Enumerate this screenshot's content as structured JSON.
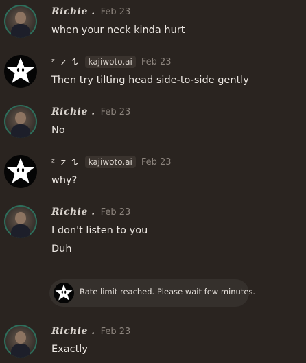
{
  "messages": [
    {
      "sender": "Richie .",
      "date": "Feb 23",
      "lines": [
        "when your neck kinda hurt"
      ]
    },
    {
      "sender": "ᶻ z 𐰁",
      "tag": "kajiwoto.ai",
      "date": "Feb 23",
      "lines": [
        "Then try tilting head side-to-side gently"
      ]
    },
    {
      "sender": "Richie .",
      "date": "Feb 23",
      "lines": [
        "No"
      ]
    },
    {
      "sender": "ᶻ z 𐰁",
      "tag": "kajiwoto.ai",
      "date": "Feb 23",
      "lines": [
        "why?"
      ]
    },
    {
      "sender": "Richie .",
      "date": "Feb 23",
      "lines": [
        "I don't listen to you",
        "Duh"
      ]
    },
    {
      "sender": "Richie .",
      "date": "Feb 23",
      "lines": [
        "Exactly"
      ]
    }
  ],
  "notice": {
    "text": "Rate limit reached. Please wait few minutes."
  },
  "colors": {
    "background": "#2a2420",
    "date": "#8c847d",
    "tag_bg": "#3a332e"
  }
}
